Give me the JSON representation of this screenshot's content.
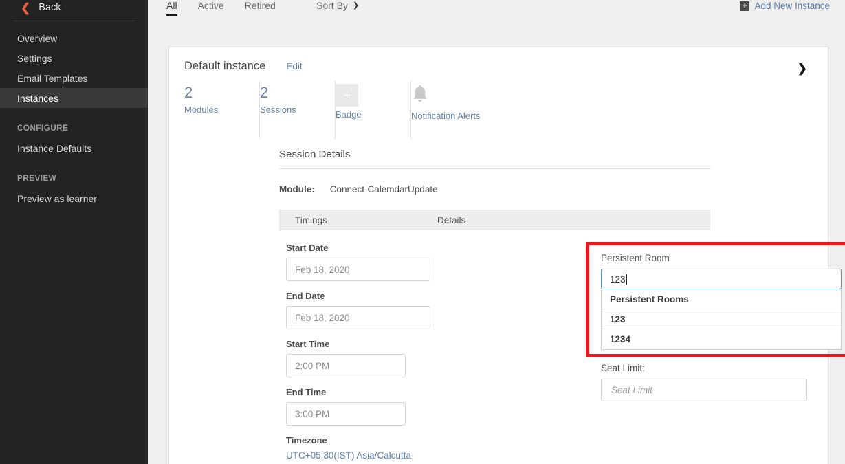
{
  "sidebar": {
    "back_label": "Back",
    "back_icon": "chevron-left-icon",
    "nav": [
      {
        "label": "Overview",
        "active": false
      },
      {
        "label": "Settings",
        "active": false
      },
      {
        "label": "Email Templates",
        "active": false
      },
      {
        "label": "Instances",
        "active": true
      }
    ],
    "sections": [
      {
        "title": "CONFIGURE",
        "items": [
          {
            "label": "Instance Defaults"
          }
        ]
      },
      {
        "title": "PREVIEW",
        "items": [
          {
            "label": "Preview as learner"
          }
        ]
      }
    ]
  },
  "tabbar": {
    "tabs": [
      {
        "label": "All",
        "selected": true
      },
      {
        "label": "Active",
        "selected": false
      },
      {
        "label": "Retired",
        "selected": false
      }
    ],
    "sort_by_label": "Sort By",
    "sort_by_icon": "chevron-down-icon",
    "add_new_label": "Add New Instance",
    "add_new_icon": "plus-icon"
  },
  "card": {
    "title": "Default instance",
    "edit_label": "Edit",
    "collapse_icon": "chevron-down-icon",
    "stats": [
      {
        "value": "2",
        "label": "Modules",
        "icon": null
      },
      {
        "value": "2",
        "label": "Sessions",
        "icon": null
      },
      {
        "value": "+",
        "label": "Badge",
        "icon": "plus-square-icon"
      },
      {
        "value": "",
        "label": "Notification Alerts",
        "icon": "bell-icon"
      }
    ]
  },
  "session": {
    "title": "Session Details",
    "module_label": "Module:",
    "module_value": "Connect-CalemdarUpdate",
    "table_headers": [
      "Timings",
      "Details"
    ],
    "timings": [
      {
        "label": "Start Date",
        "value": "Feb 18, 2020",
        "width": "date"
      },
      {
        "label": "End Date",
        "value": "Feb 18, 2020",
        "width": "date"
      },
      {
        "label": "Start Time",
        "value": "2:00 PM",
        "width": "time"
      },
      {
        "label": "End Time",
        "value": "3:00 PM",
        "width": "time"
      }
    ],
    "timezone_label": "Timezone",
    "timezone_value": "UTC+05:30(IST) Asia/Calcutta"
  },
  "persistent_room": {
    "label": "Persistent Room",
    "input_value": "123",
    "menu_heading": "Persistent Rooms",
    "options": [
      "123",
      "1234"
    ]
  },
  "seat_limit": {
    "label": "Seat Limit:",
    "value": "",
    "placeholder": "Seat Limit"
  },
  "colors": {
    "sidebar_bg": "#232323",
    "sidebar_active": "#3a3a3a",
    "back_accent": "#e2603f",
    "page_bg": "#efefef",
    "link_blue": "#5b7ba8",
    "stat_blue": "#6a84ac",
    "highlight_red": "#e01b20",
    "focus_border": "#5b8dd1"
  }
}
